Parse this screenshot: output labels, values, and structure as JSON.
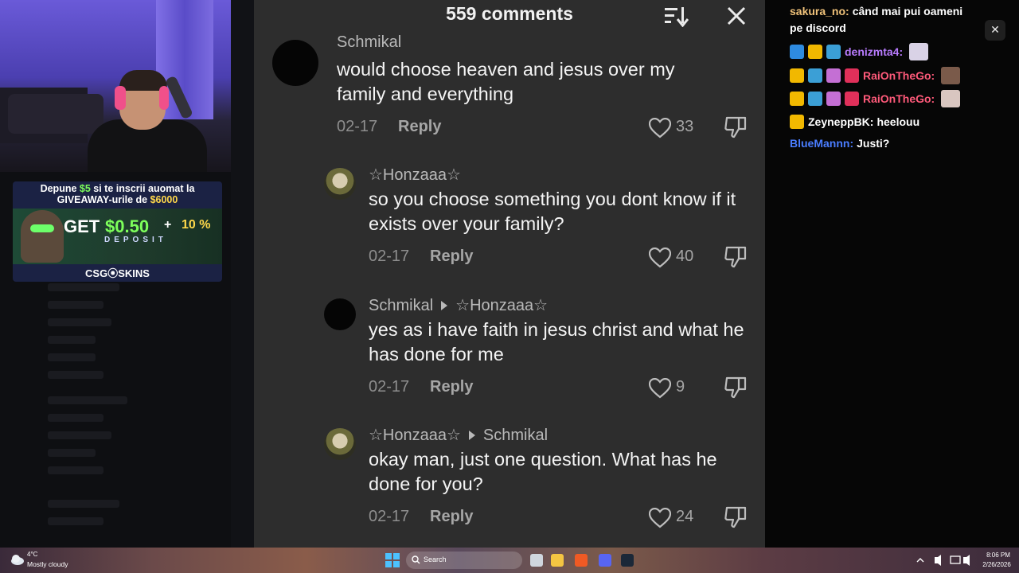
{
  "overlay_ad": {
    "line1_prefix": "Depune ",
    "line1_amount": "$5",
    "line1_suffix": " si te inscrii auomat la",
    "line2_prefix": "GIVEAWAY-urile de ",
    "line2_amount": "$6000",
    "get": "GET",
    "bonus": "$0.50",
    "plus": "+",
    "percent": "10 %",
    "deposit": "DEPOSIT",
    "brand": "CSG⦿SKINS"
  },
  "comments_panel": {
    "title": "559 comments",
    "sort_icon": "sort-icon",
    "close_icon": "close-icon",
    "comments": [
      {
        "author": "Schmikal",
        "reply_to": "",
        "text": "would choose heaven and jesus over my family and everything",
        "date": "02-17",
        "reply_label": "Reply",
        "likes": "33"
      },
      {
        "author": "☆Honzaaa☆",
        "reply_to": "",
        "text": "so you choose something you dont know if it exists over your family?",
        "date": "02-17",
        "reply_label": "Reply",
        "likes": "40"
      },
      {
        "author": "Schmikal",
        "reply_to": "☆Honzaaa☆",
        "text": "yes as i have faith in jesus christ and what he has done for me",
        "date": "02-17",
        "reply_label": "Reply",
        "likes": "9"
      },
      {
        "author": "☆Honzaaa☆",
        "reply_to": "Schmikal",
        "text": "okay man, just one question. What has he done for you?",
        "date": "02-17",
        "reply_label": "Reply",
        "likes": "24"
      }
    ]
  },
  "chat": {
    "messages": [
      {
        "user": "sakura_no:",
        "user_color": "#f0c27a",
        "text": "când mai pui oameni"
      },
      {
        "user": "",
        "user_color": "#ffffff",
        "text": "pe discord"
      },
      {
        "user": "denizmta4:",
        "user_color": "#b97cff",
        "text": ""
      },
      {
        "user": "RaiOnTheGo:",
        "user_color": "#ff5a7a",
        "text": ""
      },
      {
        "user": "RaiOnTheGo:",
        "user_color": "#ff5a7a",
        "text": ""
      },
      {
        "user": "ZeyneppBK:",
        "user_color": "#ffffff",
        "text": "heelouu"
      },
      {
        "user": "BlueMannn:",
        "user_color": "#4a7dff",
        "text": "Justi?"
      }
    ],
    "close_label": "✕"
  },
  "taskbar": {
    "weather_temp": "4°C",
    "weather_desc": "Mostly cloudy",
    "search_label": "Search",
    "time": "8:06 PM",
    "date": "2/26/2026"
  }
}
